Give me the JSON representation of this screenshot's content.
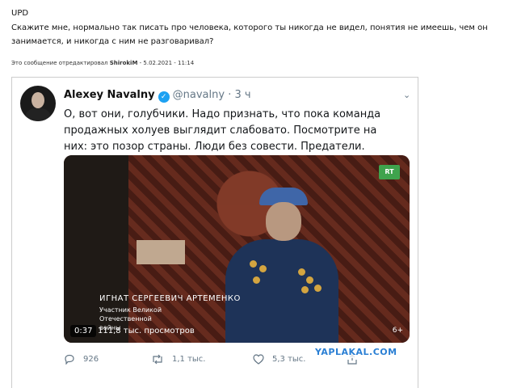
{
  "post": {
    "upd": "UPD",
    "text": "Скажите мне, нормально так писать про человека, которого ты никогда не видел, понятия не имеешь, чем он занимается, и никогда с ним не разговаривал?",
    "edited_prefix": "Это сообщение отредактировал ",
    "edited_user": "ShirokiM",
    "edited_suffix": " - 5.02.2021 - 11:14"
  },
  "tweet": {
    "name": "Alexey Navalny",
    "handle": "@navalny",
    "separator": "·",
    "time": "3 ч",
    "body": "О, вот они, голубчики. Надо признать, что пока команда продажных холуев выглядит слабовато. Посмотрите на них: это позор страны. Люди без совести. Предатели.",
    "video": {
      "channel_logo": "RT",
      "caption_name": "ИГНАТ СЕРГЕЕВИЧ АРТЕМЕНКО",
      "caption_sub": "Участник Великой Отечественной войны",
      "duration": "0:37",
      "views": "111,8 тыс. просмотров",
      "age_rating": "6+"
    },
    "actions": {
      "replies": "926",
      "retweets": "1,1 тыс.",
      "likes": "5,3 тыс."
    }
  },
  "watermark": "YAPLAKAL.COM"
}
